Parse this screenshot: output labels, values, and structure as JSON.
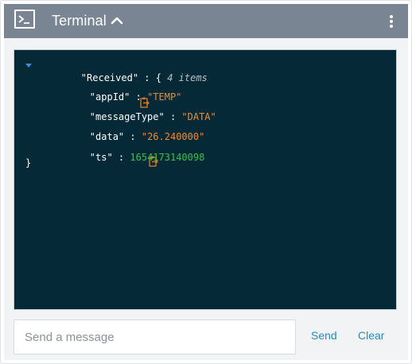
{
  "header": {
    "title": "Terminal",
    "bg_color": "#7a8593"
  },
  "console": {
    "root_key": "\"Received\"",
    "colon": " : ",
    "open_brace": "{",
    "item_count": "4 items",
    "close_brace": "}",
    "fields": [
      {
        "key": "\"appId\"",
        "value": "\"TEMP\"",
        "type": "string"
      },
      {
        "key": "\"messageType\"",
        "value": "\"DATA\"",
        "type": "string"
      },
      {
        "key": "\"data\"",
        "value": "\"26.240000\"",
        "type": "string"
      },
      {
        "key": "\"ts\"",
        "value": "1654173140098",
        "type": "number"
      }
    ],
    "colors": {
      "background": "#062937",
      "string": "#f08c2e",
      "number": "#35c24a",
      "icon": "#e07a2a"
    }
  },
  "composer": {
    "placeholder": "Send a message",
    "value": "",
    "send_label": "Send",
    "clear_label": "Clear",
    "accent": "#2a89b8"
  }
}
